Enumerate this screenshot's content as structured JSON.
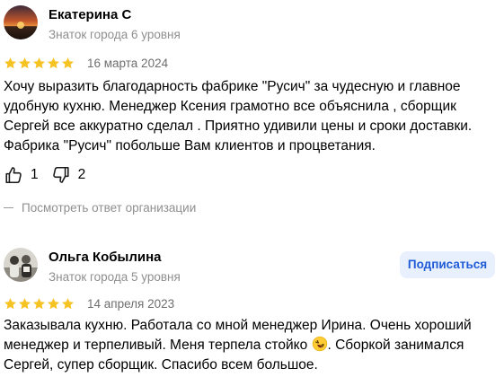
{
  "reviews": [
    {
      "author": "Екатерина С",
      "level": "Знаток города 6 уровня",
      "rating": 5,
      "date": "16 марта 2024",
      "text": "Хочу выразить благодарность фабрике \"Русич\" за чудесную и главное удобную кухню. Менеджер Ксения грамотно все объяснила , сборщик Сергей все аккуратно сделал . Приятно удивили цены и сроки доставки. Фабрика \"Русич\" побольше Вам клиентов и процветания.",
      "likes": "1",
      "dislikes": "2",
      "owner_reply_label": "Посмотреть ответ организации"
    },
    {
      "author": "Ольга Кобылина",
      "level": "Знаток города 5 уровня",
      "subscribe_label": "Подписаться",
      "rating": 5,
      "date": "14 апреля 2023",
      "text_before_emoji": "Заказывала кухню. Работала со мной менеджер Ирина. Очень хороший менеджер и терпеливый. Меня терпела стойко ",
      "text_after_emoji": ". Сборкой занимался Сергей, супер сборщик. Спасибо всем большое."
    }
  ],
  "colors": {
    "star": "#f6c324",
    "muted_text": "#8f8f8f",
    "subscribe_bg": "#e8f0fd",
    "subscribe_text": "#1f5bd6"
  },
  "icons": [
    "star-icon",
    "thumbs-up-icon",
    "thumbs-down-icon",
    "rofl-emoji"
  ]
}
